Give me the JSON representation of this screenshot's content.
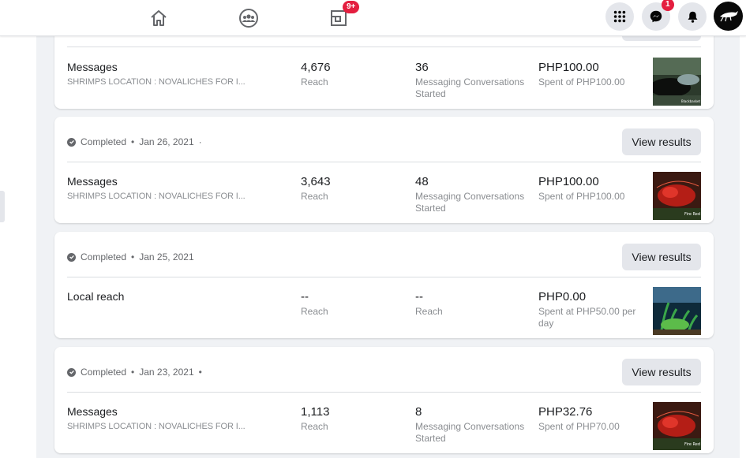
{
  "nav": {
    "groups_badge": "9+",
    "messenger_badge": "1"
  },
  "top_card": {
    "name": "Messages",
    "subtitle": "SHRIMPS LOCATION : NOVALICHES FOR I...",
    "metric1_value": "4,676",
    "metric1_label": "Reach",
    "metric2_value": "36",
    "metric2_label": "Messaging Conversations Started",
    "spend_value": "PHP100.00",
    "spend_label": "Spent of PHP100.00",
    "thumb_caption": "Blackbasket"
  },
  "cards": [
    {
      "status": "Completed",
      "date": "Jan 26, 2021",
      "button": "View results",
      "name": "Messages",
      "subtitle": "SHRIMPS LOCATION : NOVALICHES FOR I...",
      "metric1_value": "3,643",
      "metric1_label": "Reach",
      "metric2_value": "48",
      "metric2_label": "Messaging Conversations Started",
      "spend_value": "PHP100.00",
      "spend_label": "Spent of PHP100.00",
      "thumb_caption": "Fire Red"
    },
    {
      "status": "Completed",
      "date": "Jan 25, 2021",
      "button": "View results",
      "name": "Local reach",
      "subtitle": "",
      "metric1_value": "--",
      "metric1_label": "Reach",
      "metric2_value": "--",
      "metric2_label": "Reach",
      "spend_value": "PHP0.00",
      "spend_label": "Spent at PHP50.00 per day",
      "thumb_caption": ""
    },
    {
      "status": "Completed",
      "date": "Jan 23, 2021",
      "button": "View results",
      "name": "Messages",
      "subtitle": "SHRIMPS LOCATION : NOVALICHES FOR I...",
      "metric1_value": "1,113",
      "metric1_label": "Reach",
      "metric2_value": "8",
      "metric2_label": "Messaging Conversations Started",
      "spend_value": "PHP32.76",
      "spend_label": "Spent of PHP70.00",
      "thumb_caption": "Fire Red"
    }
  ],
  "colors": {
    "accent_badge": "#e41e3f",
    "button_bg": "#e4e6eb",
    "muted_text": "#8a8d91"
  }
}
